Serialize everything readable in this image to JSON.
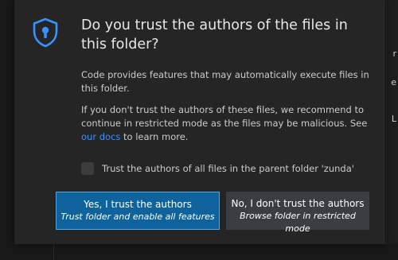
{
  "dialog": {
    "title": "Do you trust the authors of the files in this folder?",
    "paragraph1": "Code provides features that may automatically execute files in this folder.",
    "paragraph2_before_link": "If you don't trust the authors of these files, we recommend to continue in restricted mode as the files may be malicious. See ",
    "paragraph2_link": "our docs",
    "paragraph2_after_link": " to learn more.",
    "checkbox": {
      "label": "Trust the authors of all files in the parent folder 'zunda'",
      "checked": false
    },
    "trust_button": {
      "label": "Yes, I trust the authors",
      "sublabel": "Trust folder and enable all features"
    },
    "restrict_button": {
      "label": "No, I don't trust the authors",
      "sublabel": "Browse folder in restricted mode"
    },
    "icon": "shield-lock-icon"
  },
  "background": {
    "right_edge_glyphs": [
      "r",
      "e",
      "L"
    ]
  },
  "colors": {
    "accent": "#3794ff",
    "primary_button": "#0e639c",
    "secondary_button": "#3a3d41",
    "dialog_background": "#252526"
  }
}
